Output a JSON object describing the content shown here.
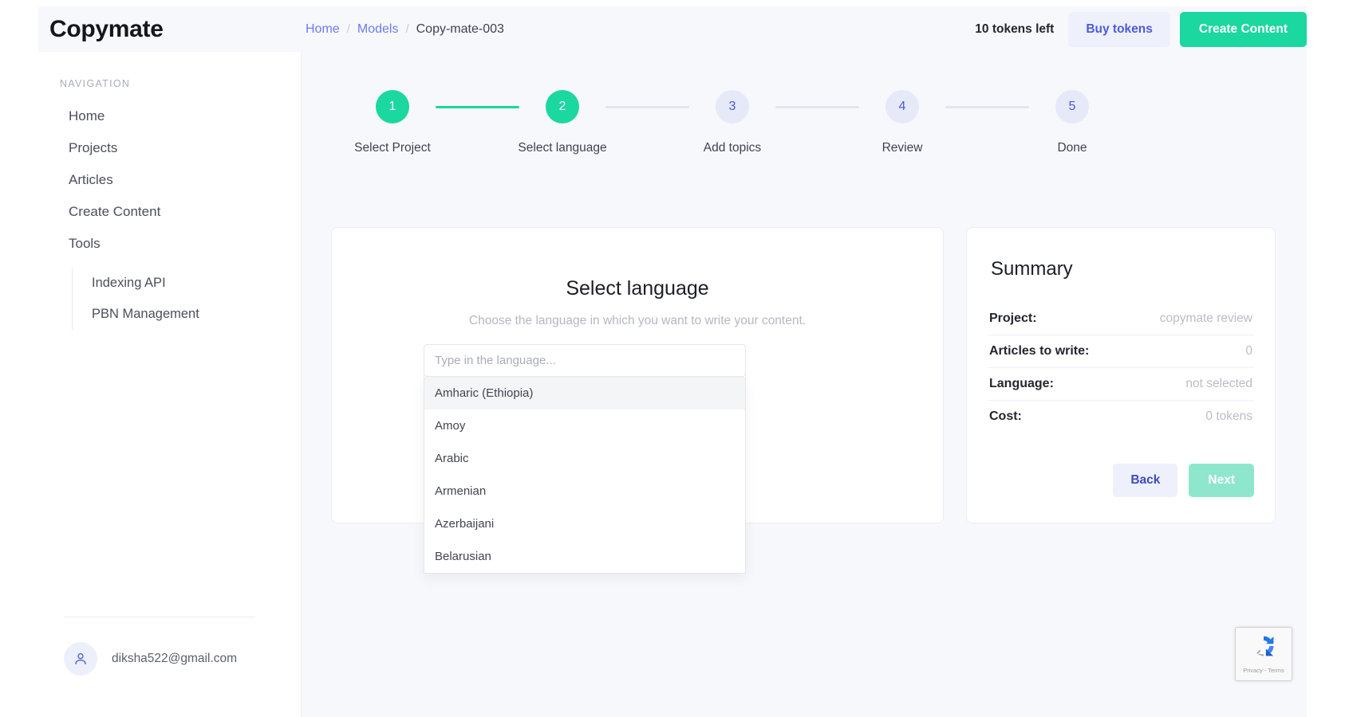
{
  "brand": {
    "name": "Copymate"
  },
  "breadcrumb": {
    "items": [
      {
        "label": "Home",
        "type": "link"
      },
      {
        "label": "Models",
        "type": "link"
      },
      {
        "label": "Copy-mate-003",
        "type": "current"
      }
    ],
    "separator": "/"
  },
  "topbar": {
    "tokens_left": "10 tokens left",
    "buy_tokens_label": "Buy tokens",
    "create_content_label": "Create Content",
    "accent_green": "#1bd7a0",
    "accent_blue": "#4b5bd7"
  },
  "sidebar": {
    "section_title": "NAVIGATION",
    "items": [
      {
        "label": "Home"
      },
      {
        "label": "Projects"
      },
      {
        "label": "Articles"
      },
      {
        "label": "Create Content"
      },
      {
        "label": "Tools"
      }
    ],
    "subitems": [
      {
        "label": "Indexing API"
      },
      {
        "label": "PBN Management"
      }
    ],
    "user": {
      "email": "diksha522@gmail.com",
      "avatar_icon": "user-icon"
    }
  },
  "stepper": {
    "steps": [
      {
        "number": "1",
        "label": "Select Project",
        "state": "done"
      },
      {
        "number": "2",
        "label": "Select language",
        "state": "done"
      },
      {
        "number": "3",
        "label": "Add topics",
        "state": "todo"
      },
      {
        "number": "4",
        "label": "Review",
        "state": "todo"
      },
      {
        "number": "5",
        "label": "Done",
        "state": "todo"
      }
    ]
  },
  "main": {
    "heading": "Select language",
    "subheading": "Choose the language in which you want to write your content.",
    "language_input": {
      "placeholder": "Type in the language...",
      "value": ""
    },
    "language_options": [
      {
        "label": "Amharic (Ethiopia)",
        "highlighted": true
      },
      {
        "label": "Amoy",
        "highlighted": false
      },
      {
        "label": "Arabic",
        "highlighted": false
      },
      {
        "label": "Armenian",
        "highlighted": false
      },
      {
        "label": "Azerbaijani",
        "highlighted": false
      },
      {
        "label": "Belarusian",
        "highlighted": false
      }
    ]
  },
  "summary": {
    "title": "Summary",
    "rows": [
      {
        "label": "Project:",
        "value": "copymate review"
      },
      {
        "label": "Articles to write:",
        "value": "0"
      },
      {
        "label": "Language:",
        "value": "not selected"
      },
      {
        "label": "Cost:",
        "value": "0 tokens"
      }
    ],
    "back_label": "Back",
    "next_label": "Next"
  },
  "recaptcha": {
    "privacy_label": "Privacy",
    "terms_label": "Terms",
    "separator": "-",
    "icon": "recaptcha-icon"
  }
}
